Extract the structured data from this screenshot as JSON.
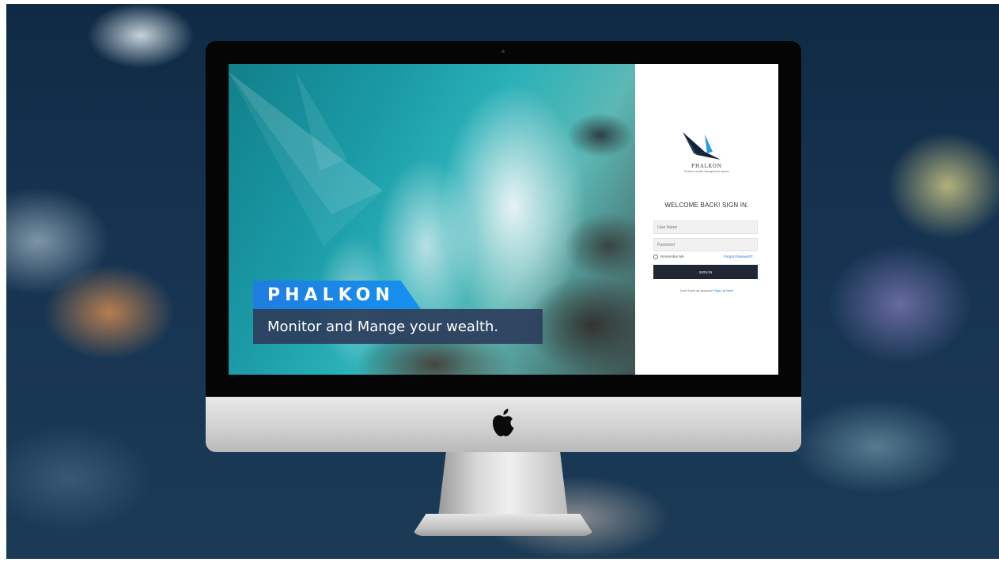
{
  "hero": {
    "brand": "PHALKON",
    "tagline": "Monitor and Mange your wealth."
  },
  "login": {
    "logo_name": "PHALKON",
    "logo_tagline": "Phalkon wealth management system",
    "welcome": "WELCOME BACK! SIGN IN.",
    "username_placeholder": "User Name",
    "password_placeholder": "Password",
    "remember_label": "Remember Me",
    "forgot_label": "Forgot Password?",
    "signin_label": "SIGN IN",
    "signup_prompt": "Don't have an account?",
    "signup_link": "Sign Up Here"
  },
  "colors": {
    "ribbon_blue": "#1591f0",
    "tagline_bg": "#2c3e5c",
    "button_dark": "#1e2733",
    "link_blue": "#1b6fd6"
  },
  "icons": [
    "apple-logo-icon",
    "phalkon-logo-icon",
    "phalkon-watermark-icon"
  ]
}
